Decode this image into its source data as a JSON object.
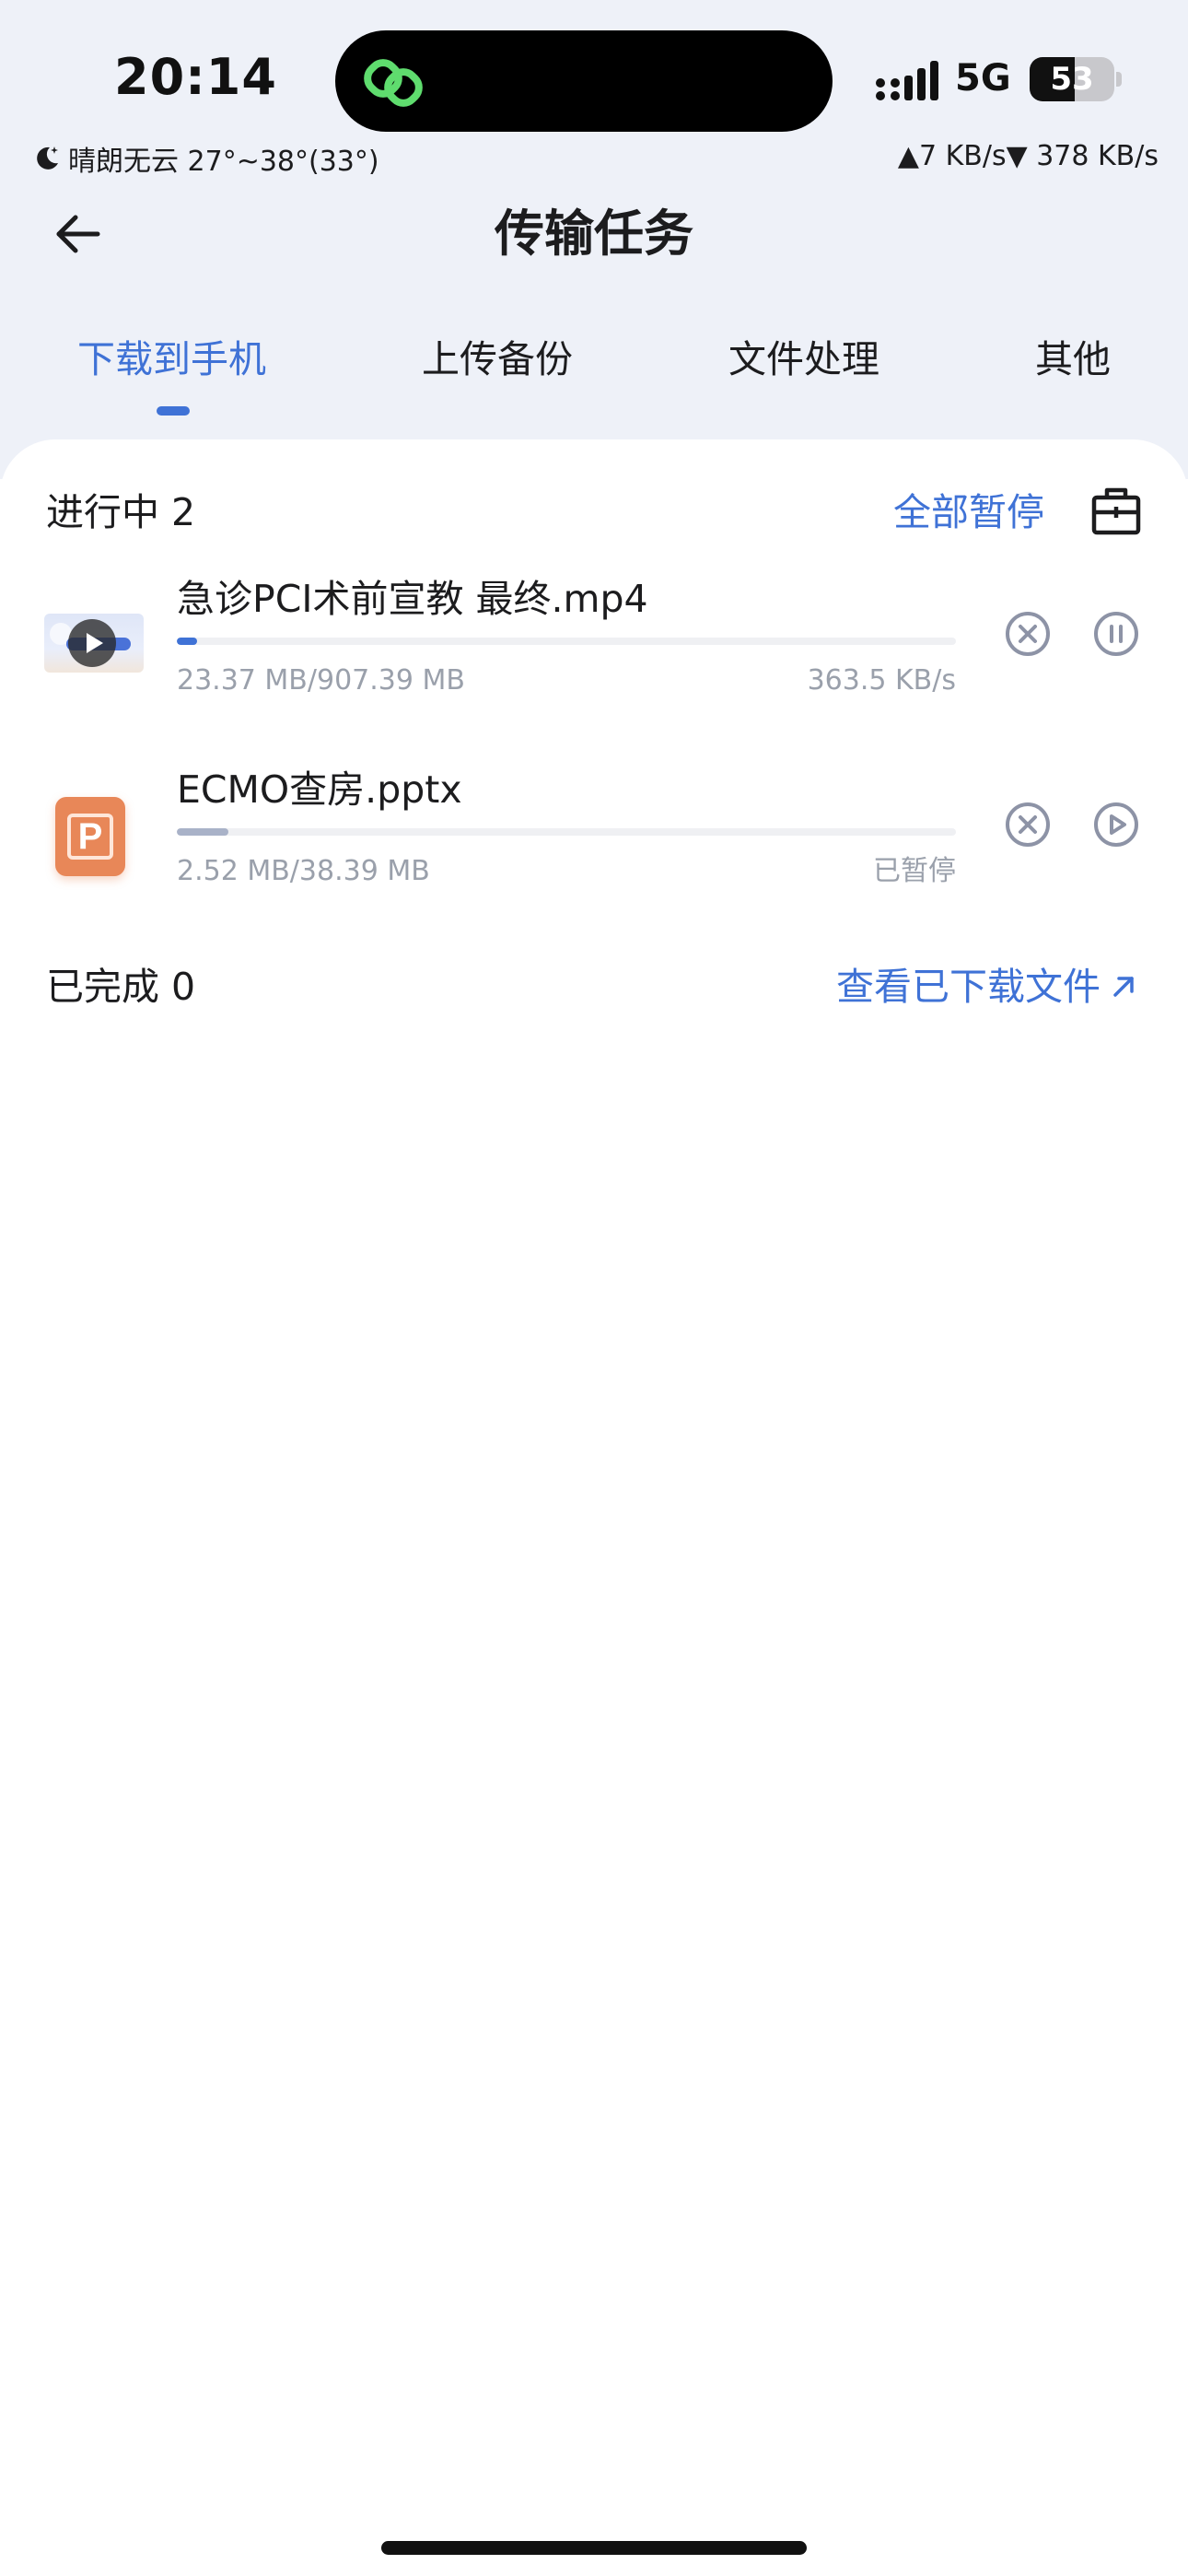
{
  "status_bar": {
    "time": "20:14",
    "network": "5G",
    "battery_level": "53",
    "weather": "晴朗无云 27°~38°(33°)",
    "speed": "▲7 KB/s▼ 378 KB/s"
  },
  "nav": {
    "title": "传输任务"
  },
  "tabs": [
    {
      "label": "下载到手机",
      "active": true
    },
    {
      "label": "上传备份",
      "active": false
    },
    {
      "label": "文件处理",
      "active": false
    },
    {
      "label": "其他",
      "active": false
    }
  ],
  "in_progress": {
    "title": "进行中 2",
    "pause_all_label": "全部暂停",
    "tasks": [
      {
        "name": "急诊PCI术前宣教 最终.mp4",
        "size": "23.37 MB/907.39 MB",
        "status": "363.5 KB/s",
        "progress": 0.026,
        "state": "downloading",
        "thumb_icon": "video-thumbnail"
      },
      {
        "name": "ECMO查房.pptx",
        "size": "2.52 MB/38.39 MB",
        "status": "已暂停",
        "progress": 0.066,
        "state": "paused",
        "thumb_icon": "ppt-file-icon"
      }
    ]
  },
  "completed": {
    "title": "已完成 0",
    "view_downloaded_label": "查看已下载文件"
  },
  "colors": {
    "accent": "#3f72d6",
    "header_bg": "#eef1f8",
    "muted_text": "#9aa0ab",
    "ppt_orange": "#e88758"
  }
}
